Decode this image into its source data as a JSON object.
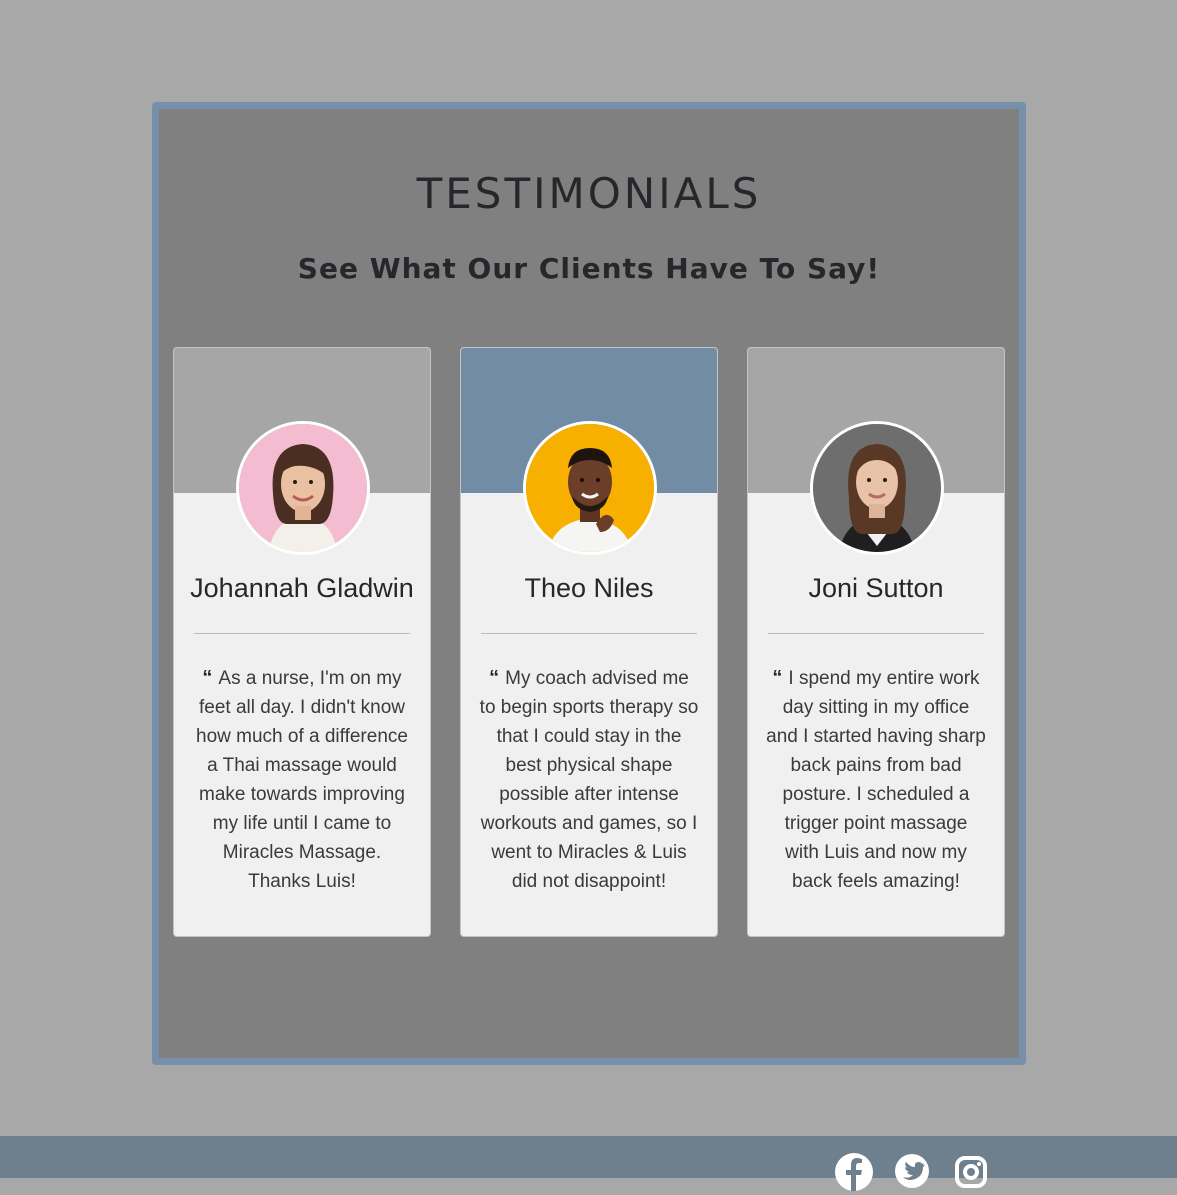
{
  "section": {
    "title": "TESTIMONIALS",
    "subtitle": "See What Our Clients Have To Say!"
  },
  "testimonials": [
    {
      "name": "Johannah Gladwin",
      "quote": "As a nurse, I'm on my feet all day. I didn't know how much of a difference a Thai massage would make towards improving my life until I came to Miracles Massage. Thanks Luis!",
      "avatar_bg": "#f4bcd0"
    },
    {
      "name": "Theo Niles",
      "quote": "My coach advised me to begin sports therapy so that I could stay in the best physical shape possible after intense workouts and games, so I went to Miracles & Luis did not disappoint!",
      "avatar_bg": "#f7b000"
    },
    {
      "name": "Joni Sutton",
      "quote": "I spend my entire work day sitting in my office and I started having sharp back pains from bad posture. I scheduled a trigger point massage with Luis and now my back feels amazing!",
      "avatar_bg": "#6e6e6e"
    }
  ],
  "quote_icon": "“",
  "footer": {
    "social_icons": [
      "facebook-icon",
      "twitter-icon",
      "instagram-icon"
    ]
  },
  "colors": {
    "page_bg": "#a8a8a8",
    "panel_bg": "#808080",
    "panel_border": "#7590a8",
    "card_banner": "#a6a6a6",
    "card_banner_accent": "#728ca6",
    "footer_bg": "#6e7f8e"
  }
}
